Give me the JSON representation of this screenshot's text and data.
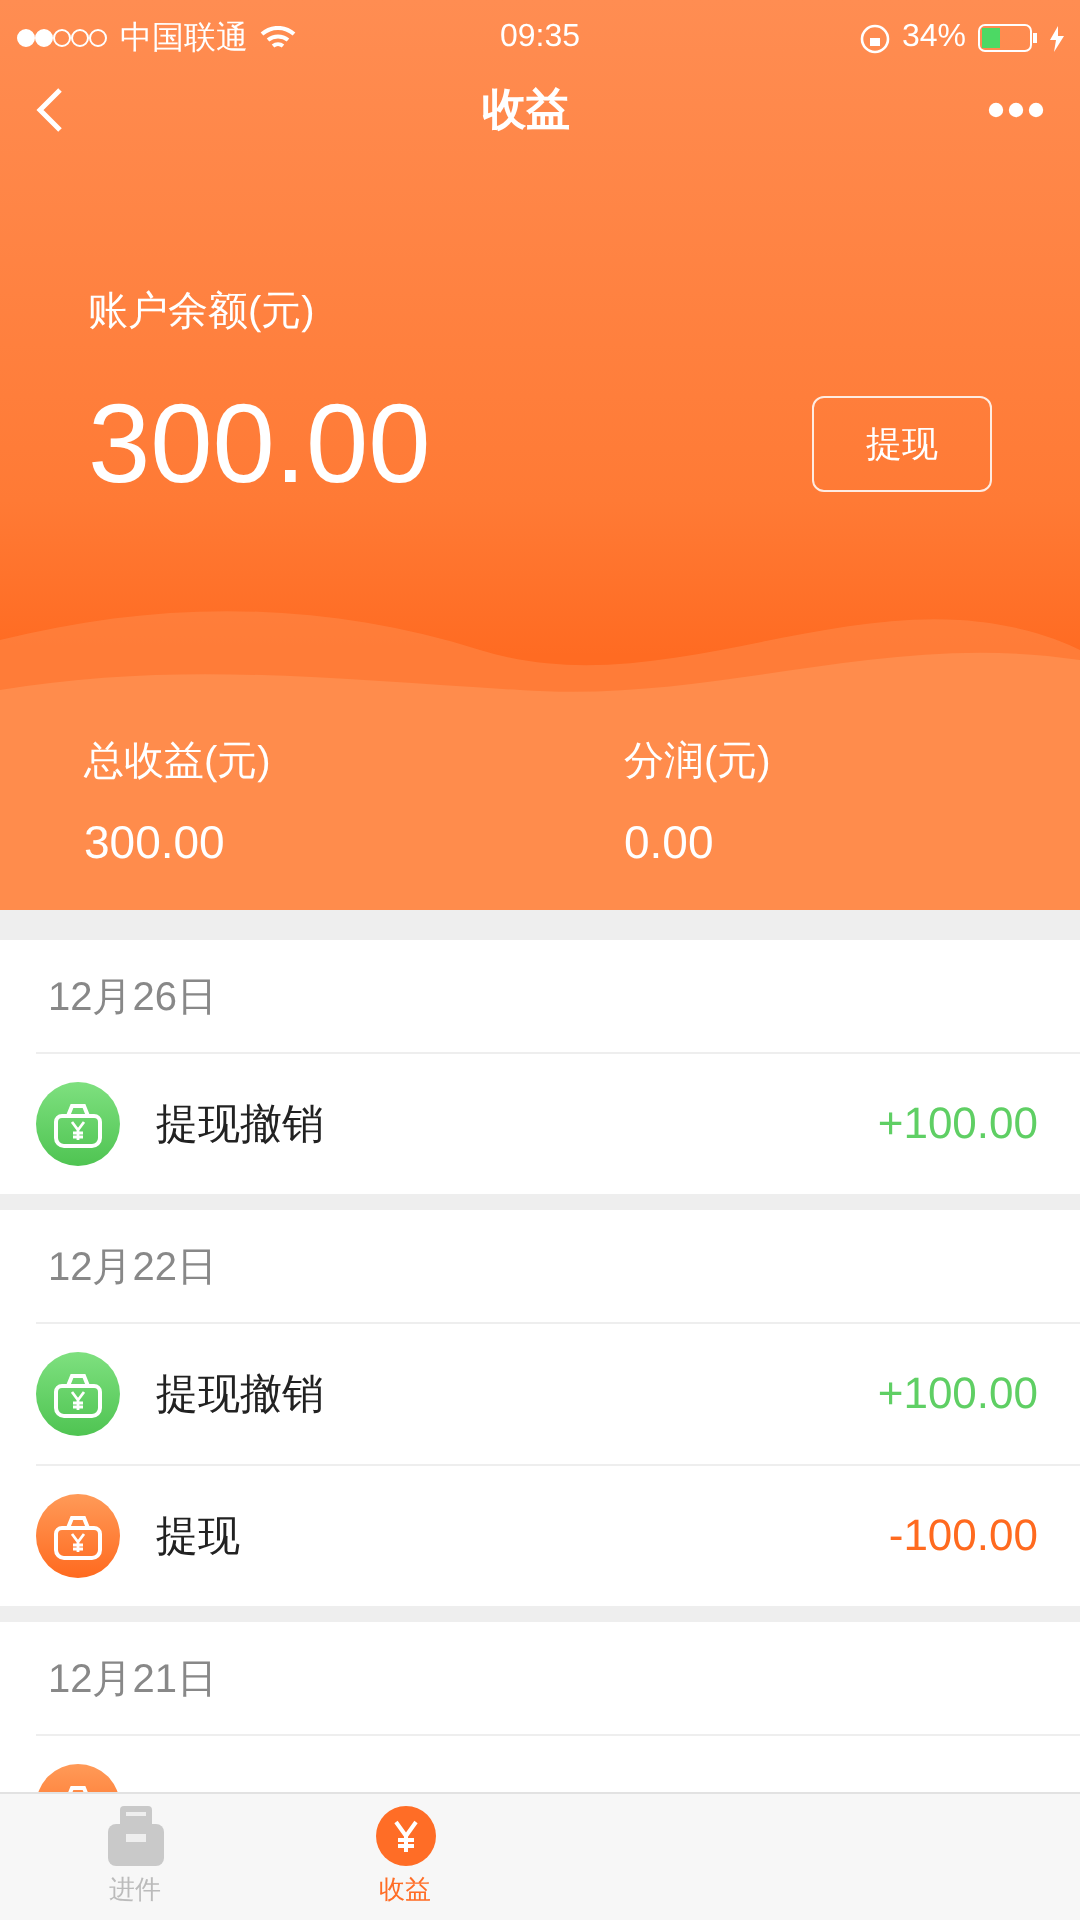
{
  "status_bar": {
    "carrier": "中国联通",
    "time": "09:35",
    "battery": "34%"
  },
  "nav": {
    "title": "收益"
  },
  "balance": {
    "label": "账户余额(元)",
    "amount": "300.00",
    "button": "提现"
  },
  "stats": [
    {
      "label": "总收益(元)",
      "value": "300.00"
    },
    {
      "label": "分润(元)",
      "value": "0.00"
    }
  ],
  "groups": [
    {
      "date": "12月26日",
      "items": [
        {
          "kind": "refund",
          "title": "提现撤销",
          "amount": "+100.00"
        }
      ]
    },
    {
      "date": "12月22日",
      "items": [
        {
          "kind": "refund",
          "title": "提现撤销",
          "amount": "+100.00"
        },
        {
          "kind": "withdraw",
          "title": "提现",
          "amount": "-100.00"
        }
      ]
    },
    {
      "date": "12月21日",
      "items": [
        {
          "kind": "withdraw"
        }
      ]
    }
  ],
  "tabs": [
    {
      "kind": "form",
      "label": "进件",
      "selected": false
    },
    {
      "kind": "money",
      "label": "收益",
      "selected": true
    }
  ]
}
